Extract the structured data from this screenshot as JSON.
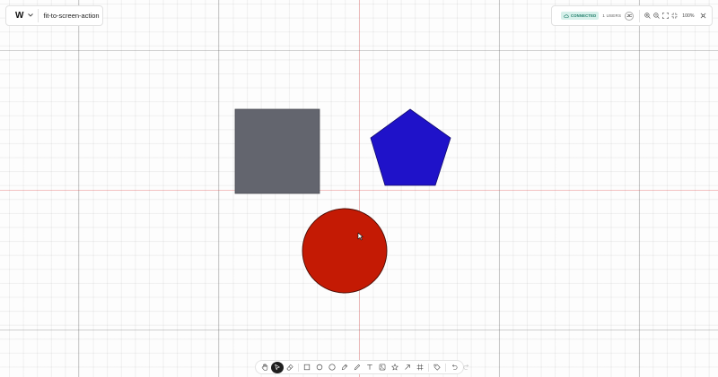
{
  "project": {
    "logo": "W",
    "name": "fit-to-screen-action"
  },
  "status": {
    "connection": "CONNECTED",
    "users": "1 USERS",
    "avatar_initials": "JC",
    "zoom": "100%"
  },
  "canvas": {
    "shapes": [
      {
        "kind": "rectangle",
        "fill": "#63656e",
        "stroke": "#4a4c53"
      },
      {
        "kind": "pentagon",
        "fill": "#1f12c9",
        "stroke": "#10096e"
      },
      {
        "kind": "circle",
        "fill": "#c41a04",
        "stroke": "#4a0c04"
      }
    ]
  },
  "toolbar": {
    "tools": [
      "hand-icon",
      "select-icon",
      "eraser-icon",
      "rectangle-icon",
      "circle-icon",
      "ellipse-icon",
      "pen-icon",
      "pencil-icon",
      "text-icon",
      "image-icon",
      "star-icon",
      "arrow-icon",
      "frame-icon",
      "tag-icon",
      "undo-icon",
      "redo-icon"
    ],
    "active_tool": "select-icon"
  },
  "colors": {
    "badge_bg": "#d6f0ea",
    "badge_fg": "#1b7a66",
    "active_tool_bg": "#1f1f1f"
  }
}
